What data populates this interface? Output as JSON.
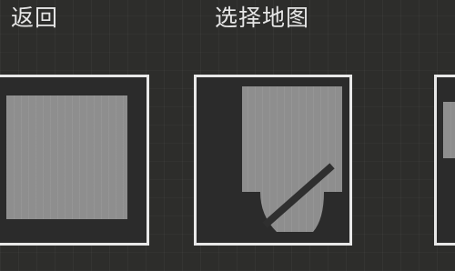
{
  "header": {
    "back_label": "返回",
    "title": "选择地图"
  },
  "maps": [
    {
      "name": "map-square"
    },
    {
      "name": "map-room-with-arc"
    },
    {
      "name": "map-partial"
    }
  ],
  "colors": {
    "background": "#2d2d2b",
    "card_border": "#e8e8e8",
    "map_fill": "#8e8e8e",
    "text": "#e6e6e6"
  }
}
